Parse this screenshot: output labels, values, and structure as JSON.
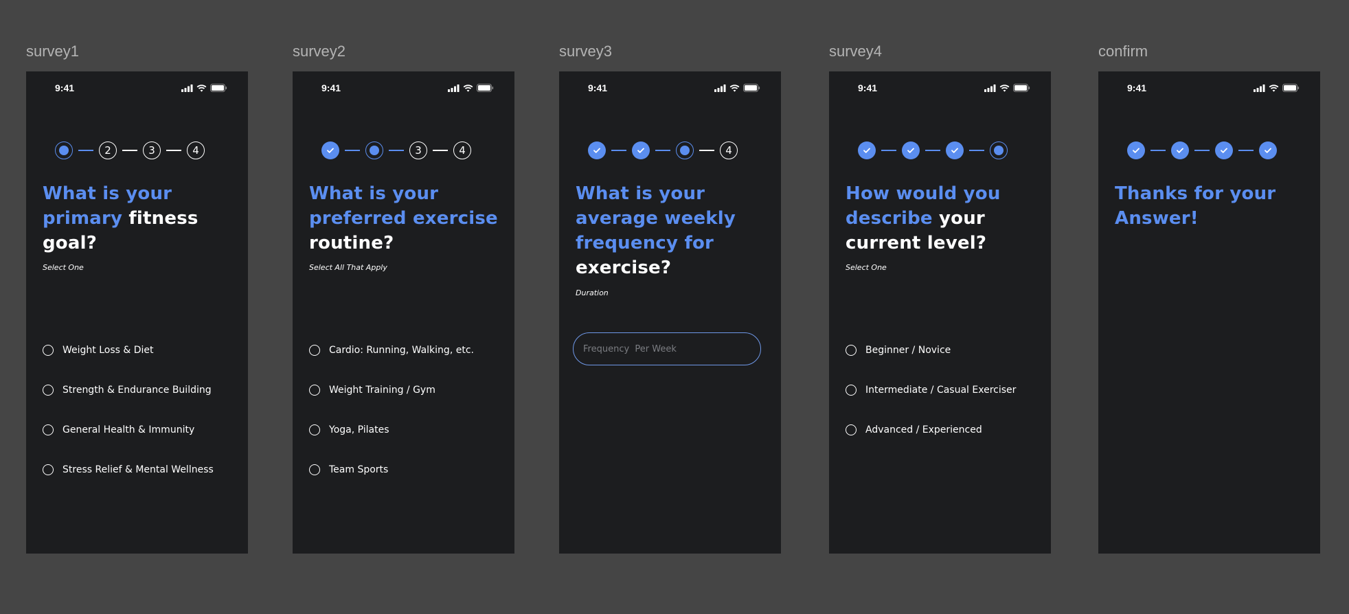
{
  "colors": {
    "background": "#454545",
    "screen": "#1c1d1f",
    "accent": "#5b8ef0",
    "text": "#ffffff",
    "label": "#b4b4b4"
  },
  "status_time": "9:41",
  "screens": {
    "survey1": {
      "frame_label": "survey1",
      "steps": [
        "current",
        "2",
        "3",
        "4"
      ],
      "question_accent": "What is your primary",
      "question_rest": "fitness goal?",
      "hint": "Select One",
      "options": [
        "Weight Loss & Diet",
        "Strength & Endurance Building",
        "General Health & Immunity",
        "Stress Relief & Mental Wellness"
      ]
    },
    "survey2": {
      "frame_label": "survey2",
      "steps": [
        "done",
        "current",
        "3",
        "4"
      ],
      "question_accent": "What is your preferred exercise",
      "question_rest": "routine?",
      "hint": "Select All That Apply",
      "options": [
        "Cardio: Running, Walking, etc.",
        "Weight Training / Gym",
        "Yoga, Pilates",
        "Team Sports"
      ]
    },
    "survey3": {
      "frame_label": "survey3",
      "steps": [
        "done",
        "done",
        "current",
        "4"
      ],
      "question_accent": "What is your average weekly frequency for",
      "question_rest": "exercise?",
      "hint": "Duration",
      "input_placeholder": "Frequency  Per Week"
    },
    "survey4": {
      "frame_label": "survey4",
      "steps": [
        "done",
        "done",
        "done",
        "current"
      ],
      "question_accent": "How would you describe",
      "question_rest": "your current level?",
      "hint": "Select One",
      "options": [
        "Beginner / Novice",
        "Intermediate / Casual Exerciser",
        "Advanced / Experienced"
      ]
    },
    "confirm": {
      "frame_label": "confirm",
      "steps": [
        "done",
        "done",
        "done",
        "done"
      ],
      "message": "Thanks for your Answer!"
    }
  }
}
